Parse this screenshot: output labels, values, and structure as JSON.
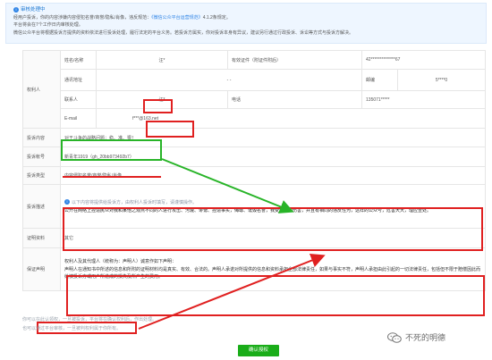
{
  "notice": {
    "title": "审核处理中",
    "line1_pre": "经用户投诉，你的内容涉嫌内容侵犯名誉/商誉/隐私/肖像，违反规范：",
    "line1_link": "《微信公众平台运营规范》",
    "line1_post": "4.1.2条规定。",
    "line2": "平台将会在7个工作日内审核处理。",
    "line3": "微信公众平台将根据投诉方提供的资料依法进行投诉处理，履行法定的平台义务。若投诉方属实，你对投诉本身有异议，建议另行通过行政投诉、诉讼等方式与投诉方解决。"
  },
  "rights_holder": {
    "section_label": "权利人",
    "name_label": "姓名/名称",
    "name_value": "汪*",
    "id_label": "有效证件（附证件附后）",
    "id_value": "42**************67",
    "address_label": "通讯地址",
    "address_value": "- -",
    "postcode_label": "邮编",
    "postcode_value": "5****0",
    "contact_label": "联系人",
    "contact_value": "汪*",
    "phone_label": "电话",
    "phone_value": "135071*****",
    "email_label": "E-mail",
    "email_value": "f***@163.net"
  },
  "complaint": {
    "content_label": "投诉内容",
    "content_value": "对王斗争的战略问题：稳、准、狠！",
    "account_label": "投诉帐号",
    "account_value": "新青年1919（gh_20bb973492b7）",
    "type_label": "投诉类型",
    "type_value": "内容侵犯名誉/商誉/隐私/肖像",
    "desc_label": "投诉描述",
    "desc_tip": "以下内容将提供给投诉方，由权利人投诉时填写，请谨慎操作。",
    "desc_text": "公开在网络上捏造民众对我和某他之观点不同的人进行攻击、污蔑、诽谤、捏造事实，侮辱、诋毁名誉，我受到严重伤害，并且有相同的违反性为，这样的公众号，危害大大，理应查处。",
    "evidence_label": "证明资料",
    "evidence_value": "其它",
    "statement_label": "保证声明",
    "statement_title": "权利人及其代理人（统称为：声明人）诚意作如下声明：",
    "statement_text": "声明人在通知书中所述的信息和所附的证明材料均是真实、有效、合法的。声明人承诺对所提供的信息和资料承担全部法律责任，如果与事实不符，声明人承担由此引起的一切法律责任，包括但不限于赔偿因此而给被投诉方或用户所造成的损失及所产生的费用。"
  },
  "footnotes": {
    "line1": "你可以在此认领权，一旦被投诉，平台将在确认权利后，作出处理。",
    "line2": "也可以通过平台审核，一旦被判权利属于你所有。"
  },
  "confirm_button": "确认授权",
  "watermark": "不死的明德",
  "colors": {
    "highlight_red": "#e02020",
    "highlight_green": "#28b428",
    "accent_blue": "#2f84e6",
    "button_green": "#1aad19"
  }
}
